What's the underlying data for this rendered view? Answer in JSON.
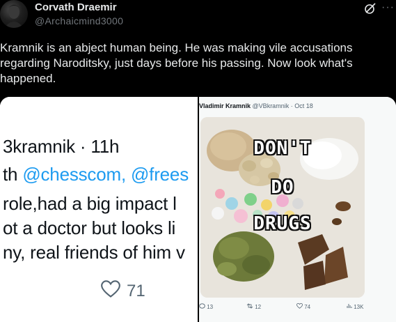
{
  "post": {
    "author_name": "Corvath Draemir",
    "author_handle": "@Archaicmind3000",
    "text": "Kramnik is an abject human being. He was making vile accusations regarding Naroditsky, just days before his passing. Now look what's happened.",
    "icons": [
      "grok-icon",
      "more-icon"
    ]
  },
  "media": {
    "left_screenshot": {
      "line1": "3kramnik · 11h",
      "line2_prefix": "th ",
      "line2_mention1": "@chesscom,",
      "line2_mention2": " @frees",
      "line3": "role,had a big impact l",
      "line4": "ot a doctor but looks li",
      "line5": "ny, real friends of him v",
      "like_count": "71"
    },
    "right_screenshot": {
      "author_name": "Vladimir Kramnik",
      "author_handle": "@VBkramnik",
      "date": "· Oct 18",
      "image_text": [
        "DON'T",
        "DO",
        "DRUGS"
      ],
      "replies": "13",
      "reposts": "12",
      "likes": "74",
      "views": "13K"
    }
  },
  "colors": {
    "background": "#000000",
    "text": "#e7e9ea",
    "secondary_text": "#71767b",
    "link_blue": "#1d9bf0"
  }
}
